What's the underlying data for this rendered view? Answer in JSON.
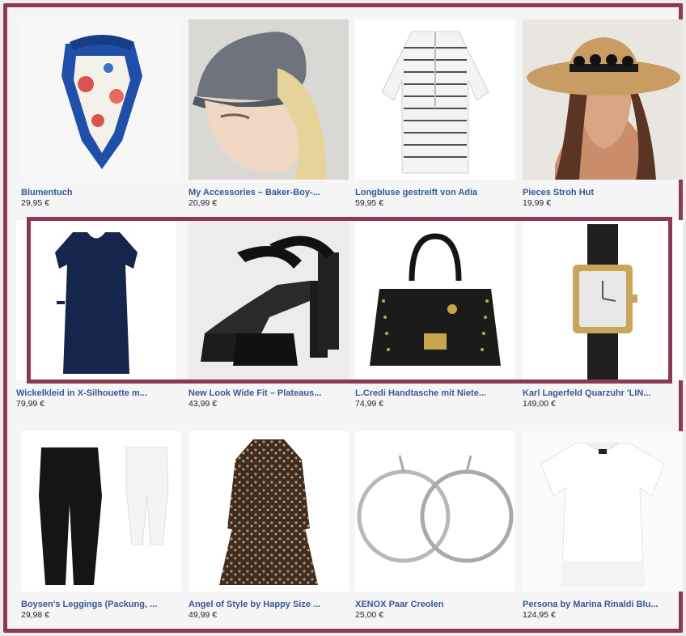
{
  "products": [
    {
      "name": "Blumentuch",
      "price": "29,95 €"
    },
    {
      "name": "My Accessories – Baker-Boy-...",
      "price": "20,99 €"
    },
    {
      "name": "Longbluse gestreift von Adia",
      "price": "59,95 €"
    },
    {
      "name": "Pieces Stroh Hut",
      "price": "19,99 €"
    },
    {
      "name": "Wickelkleid in X-Silhouette m...",
      "price": "79,99 €"
    },
    {
      "name": "New Look Wide Fit – Plateaus...",
      "price": "43,99 €"
    },
    {
      "name": "L.Credi Handtasche mit Niete...",
      "price": "74,99 €"
    },
    {
      "name": "Karl Lagerfeld Quarzuhr 'LIN...",
      "price": "149,00 €"
    },
    {
      "name": "Boysen's Leggings (Packung, ...",
      "price": "29,98 €"
    },
    {
      "name": "Angel of Style by Happy Size ...",
      "price": "49,99 €"
    },
    {
      "name": "XENOX Paar Creolen",
      "price": "25,00 €"
    },
    {
      "name": "Persona by Marina Rinaldi Blu...",
      "price": "124,95 €"
    }
  ],
  "colors": {
    "frame": "#8c3a52",
    "link": "#365899",
    "price": "#1d2129"
  }
}
